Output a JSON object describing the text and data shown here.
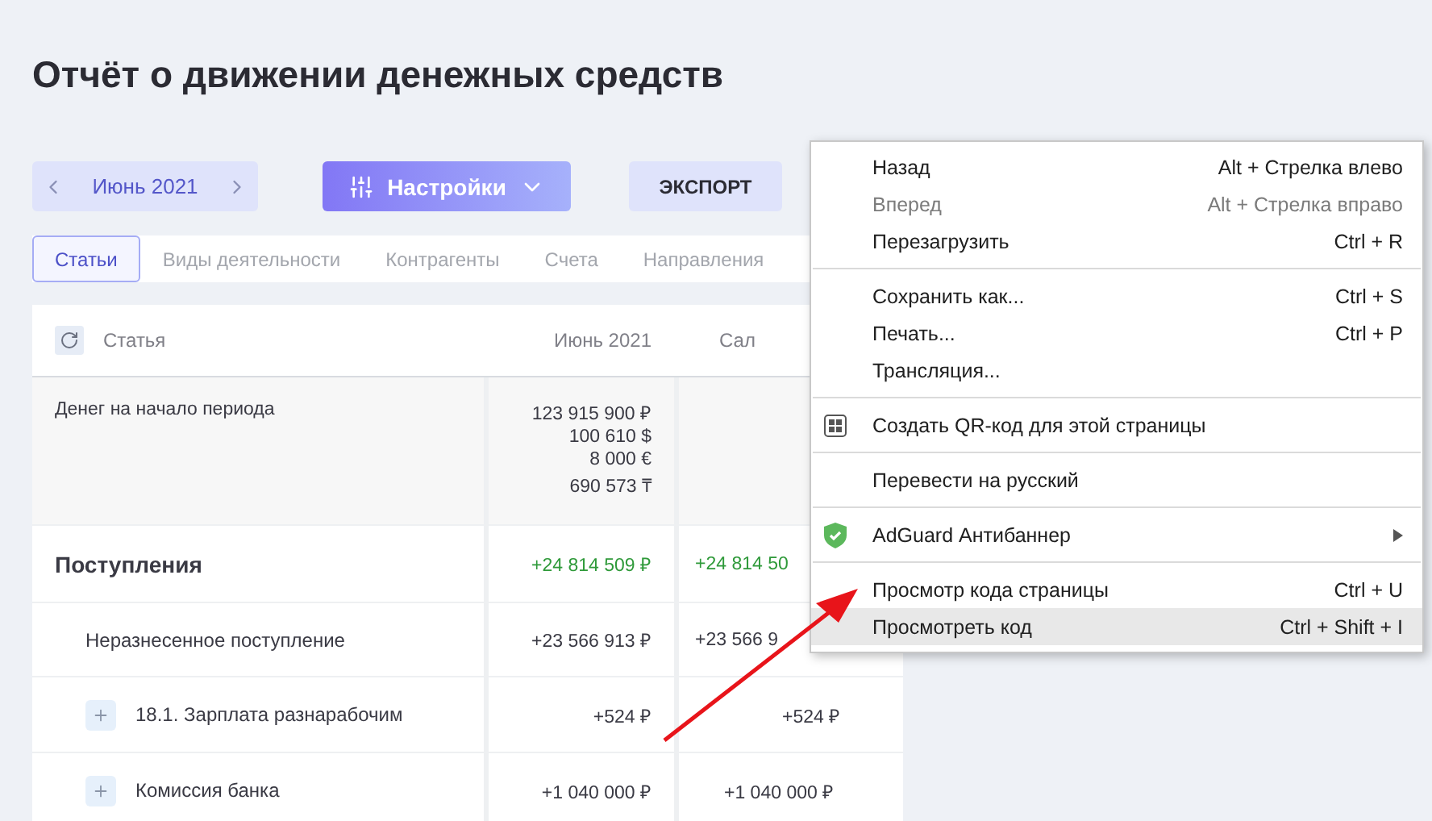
{
  "title": "Отчёт о движении денежных средств",
  "period": {
    "label": "Июнь 2021"
  },
  "settings_button": {
    "label": "Настройки"
  },
  "export_button": {
    "label": "ЭКСПОРТ"
  },
  "tabs": [
    {
      "label": "Статьи",
      "selected": true
    },
    {
      "label": "Виды деятельности",
      "selected": false
    },
    {
      "label": "Контрагенты",
      "selected": false
    },
    {
      "label": "Счета",
      "selected": false
    },
    {
      "label": "Направления",
      "selected": false
    }
  ],
  "table": {
    "columns": [
      "Статья",
      "Июнь 2021",
      "Сал"
    ],
    "rows": [
      {
        "kind": "balance",
        "cells": [
          [
            "Денег на начало периода"
          ],
          [
            "123 915 900 ₽",
            "100 610 $",
            "8 000 €",
            "690 573 ₸"
          ],
          []
        ]
      },
      {
        "kind": "group",
        "cells": [
          [
            "Поступления"
          ],
          [
            "+24 814 509 ₽"
          ],
          [
            "+24 814 50"
          ]
        ]
      },
      {
        "kind": "item",
        "cells": [
          [
            "Неразнесенное поступление"
          ],
          [
            "+23 566 913 ₽"
          ],
          [
            "+23 566 9"
          ]
        ]
      },
      {
        "kind": "expandable",
        "cells": [
          [
            "18.1. Зарплата разнарабочим"
          ],
          [
            "+524 ₽"
          ],
          [
            "+524 ₽"
          ]
        ]
      },
      {
        "kind": "expandable",
        "cells": [
          [
            "Комиссия банка"
          ],
          [
            "+1 040 000 ₽"
          ],
          [
            "+1 040 000 ₽"
          ]
        ]
      }
    ]
  },
  "context_menu": {
    "sections": [
      [
        {
          "kind": "command",
          "label": "Назад",
          "shortcut": "Alt + Стрелка влево",
          "disabled": false,
          "highlighted": false
        },
        {
          "kind": "command",
          "label": "Вперед",
          "shortcut": "Alt + Стрелка вправо",
          "disabled": true,
          "highlighted": false
        },
        {
          "kind": "command",
          "label": "Перезагрузить",
          "shortcut": "Ctrl + R",
          "disabled": false,
          "highlighted": false
        }
      ],
      [
        {
          "kind": "command",
          "label": "Сохранить как...",
          "shortcut": "Ctrl + S",
          "disabled": false,
          "highlighted": false
        },
        {
          "kind": "command",
          "label": "Печать...",
          "shortcut": "Ctrl + P",
          "disabled": false,
          "highlighted": false
        },
        {
          "kind": "command",
          "label": "Трансляция...",
          "disabled": false,
          "highlighted": false
        }
      ],
      [
        {
          "kind": "qr-code",
          "label": "Создать QR-код для этой страницы",
          "disabled": false,
          "highlighted": false
        }
      ],
      [
        {
          "kind": "command",
          "label": "Перевести на русский",
          "disabled": false,
          "highlighted": false
        }
      ],
      [
        {
          "kind": "extension",
          "label": "AdGuard Антибаннер",
          "disabled": false,
          "highlighted": false
        }
      ],
      [
        {
          "kind": "command",
          "label": "Просмотр кода страницы",
          "shortcut": "Ctrl + U",
          "disabled": false,
          "highlighted": false
        },
        {
          "kind": "command",
          "label": "Просмотреть код",
          "shortcut": "Ctrl + Shift + I",
          "disabled": false,
          "highlighted": true
        }
      ]
    ]
  }
}
